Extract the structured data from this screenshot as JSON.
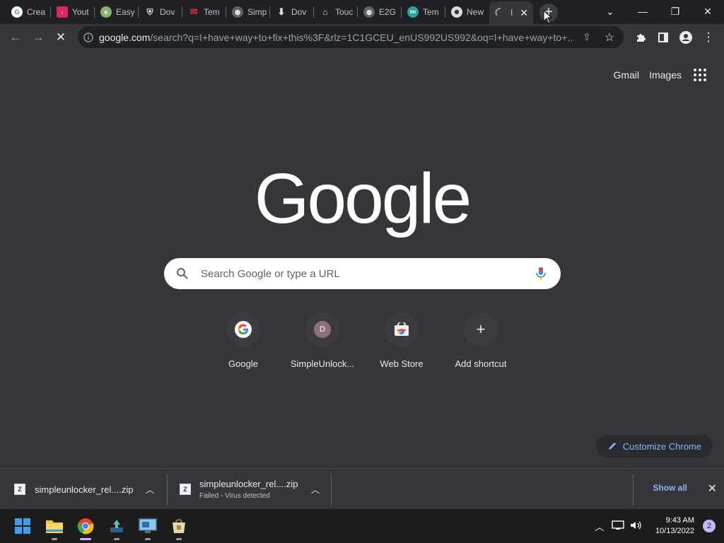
{
  "tabs": [
    {
      "title": "Crea",
      "icon": "google-icon",
      "color": "#ffffff"
    },
    {
      "title": "Yout",
      "icon": "download-red-icon",
      "color": "#e0245e"
    },
    {
      "title": "Easy",
      "icon": "easy-icon",
      "color": "#8bb26a"
    },
    {
      "title": "Dov",
      "icon": "shield-icon",
      "color": "#dadce0"
    },
    {
      "title": "Tem",
      "icon": "mail-icon",
      "color": "#d93025"
    },
    {
      "title": "Simp",
      "icon": "globe-icon",
      "color": "#9aa0a6"
    },
    {
      "title": "Dov",
      "icon": "download-icon",
      "color": "#dadce0"
    },
    {
      "title": "Touc",
      "icon": "store-icon",
      "color": "#dadce0"
    },
    {
      "title": "E2G",
      "icon": "globe-icon",
      "color": "#9aa0a6"
    },
    {
      "title": "Tem",
      "icon": "tem-icon",
      "color": "#26a69a"
    },
    {
      "title": "New",
      "icon": "chrome-icon",
      "color": "#dadce0"
    },
    {
      "title": "I",
      "icon": "loading-icon",
      "color": "#9aa0a6",
      "active": true
    }
  ],
  "omnibox": {
    "url_host": "google.com",
    "url_path": "/search?q=I+have+way+to+fix+this%3F&rlz=1C1GCEU_enUS992US992&oq=I+have+way+to+..."
  },
  "page": {
    "gmail_label": "Gmail",
    "images_label": "Images",
    "logo_text": "Google",
    "search_placeholder": "Search Google or type a URL",
    "shortcuts": [
      {
        "label": "Google",
        "icon": "google-icon"
      },
      {
        "label": "SimpleUnlock...",
        "icon": "letter-avatar-icon",
        "letter": "D"
      },
      {
        "label": "Web Store",
        "icon": "web-store-icon"
      },
      {
        "label": "Add shortcut",
        "icon": "plus-icon"
      }
    ],
    "customize_label": "Customize Chrome"
  },
  "downloads": {
    "items": [
      {
        "name": "simpleunlocker_rel....zip",
        "status": ""
      },
      {
        "name": "simpleunlocker_rel....zip",
        "status": "Failed - Virus detected"
      }
    ],
    "show_all_label": "Show all"
  },
  "taskbar": {
    "time": "9:43 AM",
    "date": "10/13/2022",
    "notification_count": "2"
  },
  "colors": {
    "accent_blue": "#8ab4f8",
    "page_bg": "#35363a",
    "chrome_bg": "#202124"
  }
}
